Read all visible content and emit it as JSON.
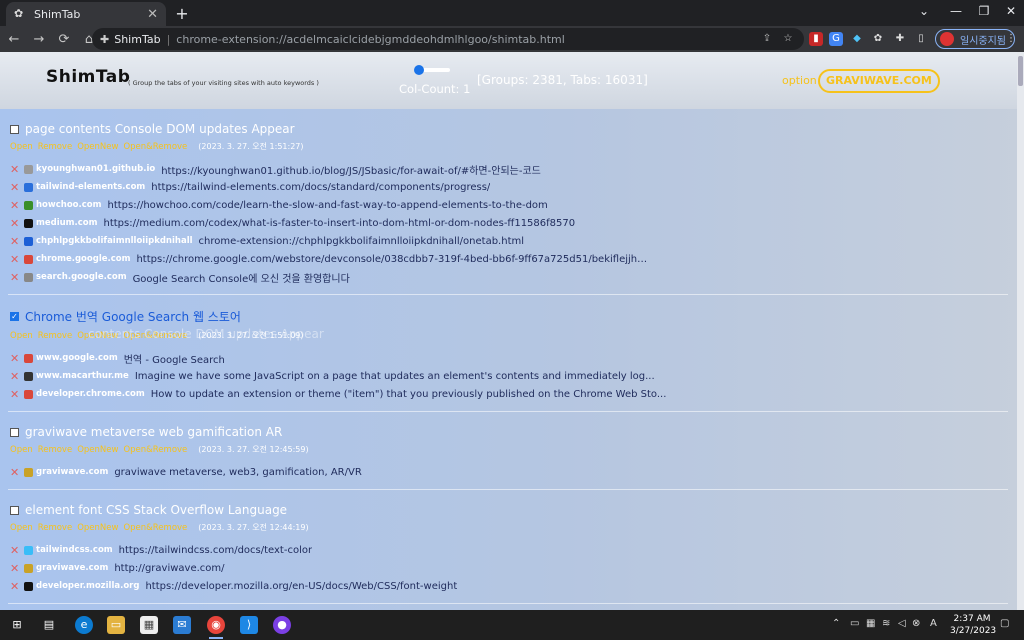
{
  "browser": {
    "tab_title": "ShimTab",
    "tab_close": "✕",
    "new_tab": "+",
    "window_controls": {
      "expand": "⌄",
      "minimize": "—",
      "restore": "❐",
      "close": "✕"
    },
    "nav": {
      "back": "←",
      "forward": "→",
      "reload": "⟳",
      "home": "⌂"
    },
    "omnibox": {
      "site": "ShimTab",
      "separator": "|",
      "url": "chrome-extension://acdelmcaiclcidebjgmddeohdmlhlgoo/shimtab.html"
    },
    "profile_pause_label": "일시중지됨"
  },
  "app": {
    "logo": "ShimTab",
    "subtitle": "( Group the tabs of your visiting sites with auto keywords )",
    "col_count": "Col-Count: 1",
    "col_count_value": 1,
    "slider_fraction": 0.0,
    "stats": "[Groups: 2381, Tabs: 16031]",
    "option_label": "option",
    "brand_button": "GRAVIWAVE.COM",
    "colors": {
      "accent": "#f6c21b",
      "remove": "#e06060",
      "checked": "#1a73e8"
    }
  },
  "actions": {
    "open": "Open",
    "remove": "Remove",
    "open_new": "OpenNew",
    "open_remove": "Open&Remove"
  },
  "groups": [
    {
      "title": "page contents Console DOM updates Appear",
      "checked": false,
      "date": "(2023. 3. 27. 오전 1:51:27)",
      "tabs": [
        {
          "host": "kyounghwan01.github.io",
          "text": "https://kyounghwan01.github.io/blog/JS/JSbasic/for-await-of/#하면-안되는-코드",
          "icon_color": "#999"
        },
        {
          "host": "tailwind-elements.com",
          "text": "https://tailwind-elements.com/docs/standard/components/progress/",
          "icon_color": "#2a6fdb"
        },
        {
          "host": "howchoo.com",
          "text": "https://howchoo.com/code/learn-the-slow-and-fast-way-to-append-elements-to-the-dom",
          "icon_color": "#3a8f2a"
        },
        {
          "host": "medium.com",
          "text": "https://medium.com/codex/what-is-faster-to-insert-into-dom-html-or-dom-nodes-ff11586f8570",
          "icon_color": "#111"
        },
        {
          "host": "chphlpgkkbolifaimnlloiipkdnihall",
          "text": "chrome-extension://chphlpgkkbolifaimnlloiipkdnihall/onetab.html",
          "icon_color": "#1c5fd6"
        },
        {
          "host": "chrome.google.com",
          "text": "https://chrome.google.com/webstore/devconsole/038cdbb7-319f-4bed-bb6f-9ff67a725d51/bekiflejjhmdp...",
          "icon_color": "#d9473b"
        },
        {
          "host": "search.google.com",
          "text": "Google Search Console에 오신 것을 환영합니다",
          "icon_color": "#888"
        }
      ]
    },
    {
      "title": "Chrome 번역 Google Search 웹 스토어",
      "ghost": "contents Console DOM updates Appear",
      "checked": true,
      "date": "(2023. 3. 27. 오전 1:51:09)",
      "tabs": [
        {
          "host": "www.google.com",
          "text": "번역 - Google Search",
          "icon_color": "#d9473b"
        },
        {
          "host": "www.macarthur.me",
          "text": "Imagine we have some JavaScript on a page that updates an element's contents and immediately log...",
          "icon_color": "#333"
        },
        {
          "host": "developer.chrome.com",
          "text": "How to update an extension or theme (\"item\") that you previously published on the Chrome Web Sto...",
          "icon_color": "#d9473b"
        }
      ]
    },
    {
      "title": "graviwave metaverse web gamification AR",
      "checked": false,
      "date": "(2023. 3. 27. 오전 12:45:59)",
      "tabs": [
        {
          "host": "graviwave.com",
          "text": "graviwave metaverse, web3, gamification, AR/VR",
          "icon_color": "#c9a227"
        }
      ]
    },
    {
      "title": "element font CSS Stack Overflow Language",
      "checked": false,
      "date": "(2023. 3. 27. 오전 12:44:19)",
      "tabs": [
        {
          "host": "tailwindcss.com",
          "text": "https://tailwindcss.com/docs/text-color",
          "icon_color": "#38bdf8"
        },
        {
          "host": "graviwave.com",
          "text": "http://graviwave.com/",
          "icon_color": "#c9a227"
        },
        {
          "host": "developer.mozilla.org",
          "text": "https://developer.mozilla.org/en-US/docs/Web/CSS/font-weight",
          "icon_color": "#111"
        }
      ]
    }
  ],
  "taskbar": {
    "time": "2:37 AM",
    "date": "3/27/2023"
  }
}
